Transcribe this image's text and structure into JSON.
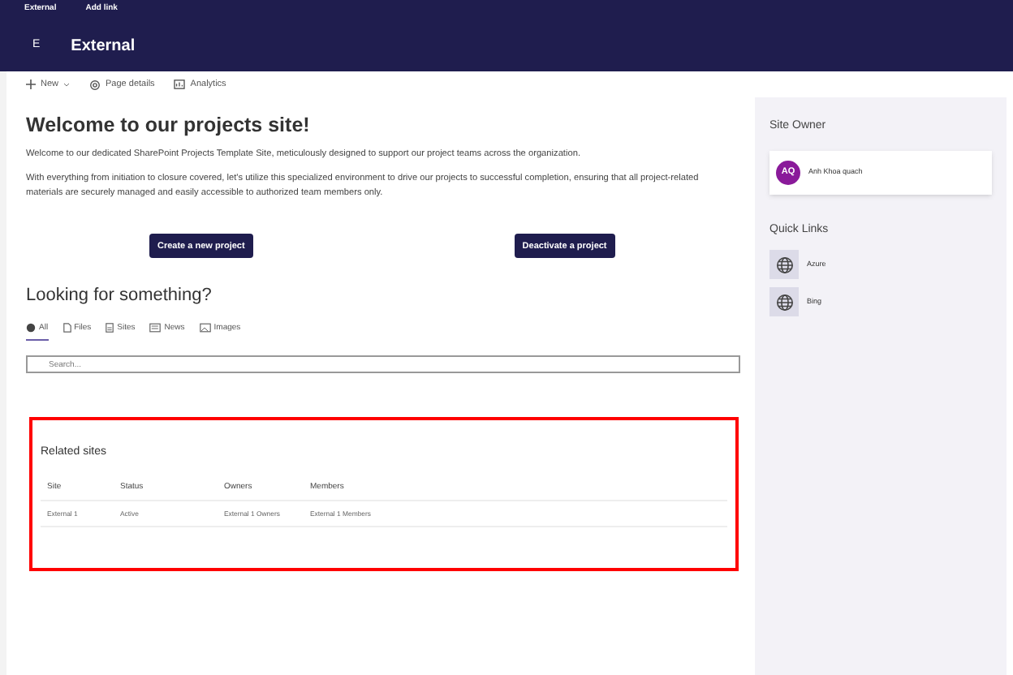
{
  "suite_bar": {
    "links": [
      "External",
      "Add link"
    ]
  },
  "site_header": {
    "logo_letter": "E",
    "title": "External"
  },
  "command_bar": [
    {
      "kind": "new",
      "label": "New"
    },
    {
      "kind": "details",
      "label": "Page details"
    },
    {
      "kind": "analytics",
      "label": "Analytics"
    }
  ],
  "welcome": {
    "title": "Welcome to our projects site!",
    "paragraphs": [
      "Welcome to our dedicated SharePoint Projects Template Site, meticulously designed to support our project teams across the organization.",
      "With everything from initiation to closure covered, let's utilize this specialized environment to drive our projects to successful completion, ensuring that all project-related materials are securely managed and easily accessible to authorized team members only."
    ],
    "buttons": [
      "Create a new project",
      "Deactivate a project"
    ]
  },
  "search_section": {
    "title": "Looking for something?",
    "tabs": [
      {
        "kind": "all",
        "label": "All",
        "selected": true
      },
      {
        "kind": "files",
        "label": "Files",
        "selected": false
      },
      {
        "kind": "sites",
        "label": "Sites",
        "selected": false
      },
      {
        "kind": "news",
        "label": "News",
        "selected": false
      },
      {
        "kind": "images",
        "label": "Images",
        "selected": false
      }
    ],
    "search": {
      "placeholder": "Search..."
    }
  },
  "related_sites": {
    "highlighted": true,
    "title": "Related sites",
    "columns": [
      "Site",
      "Status",
      "Owners",
      "Members"
    ],
    "rows": [
      [
        "External 1",
        "Active",
        "External 1 Owners",
        "External 1 Members"
      ]
    ]
  },
  "sidebar": {
    "site_owner": {
      "title": "Site Owner",
      "initials": "AQ",
      "name": "Anh Khoa quach"
    },
    "quick_links": {
      "title": "Quick Links",
      "items": [
        "Azure",
        "Bing"
      ]
    }
  }
}
